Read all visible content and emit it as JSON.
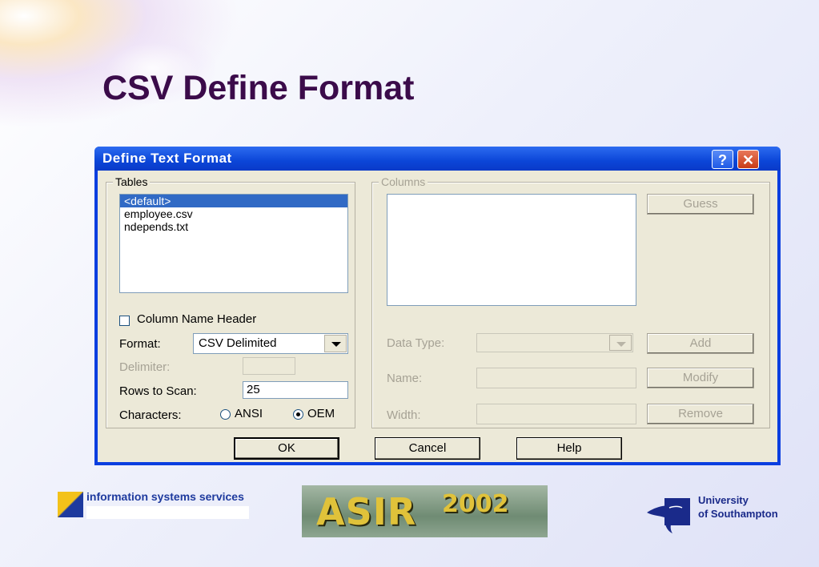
{
  "slide": {
    "title": "CSV Define Format"
  },
  "dialog": {
    "title": "Define Text Format",
    "help_glyph": "?",
    "close_glyph": "✕",
    "tables": {
      "legend": "Tables",
      "items": [
        "<default>",
        "employee.csv",
        "ndepends.txt"
      ],
      "selected_index": 0
    },
    "column_name_header": {
      "label": "Column Name Header",
      "checked": false
    },
    "format": {
      "label": "Format:",
      "value": "CSV Delimited"
    },
    "delimiter": {
      "label": "Delimiter:",
      "value": ""
    },
    "rows_to_scan": {
      "label": "Rows to Scan:",
      "value": "25"
    },
    "characters": {
      "label": "Characters:",
      "options": [
        "ANSI",
        "OEM"
      ],
      "selected": "OEM"
    },
    "columns": {
      "legend": "Columns",
      "data_type_label": "Data Type:",
      "name_label": "Name:",
      "width_label": "Width:"
    },
    "buttons": {
      "guess": "Guess",
      "add": "Add",
      "modify": "Modify",
      "remove": "Remove",
      "ok": "OK",
      "cancel": "Cancel",
      "help": "Help"
    }
  },
  "footer": {
    "iss": "information systems services",
    "asir": "ASIR",
    "asir_year": "2002",
    "uos_line1": "University",
    "uos_line2": "of Southampton"
  },
  "colors": {
    "title": "#3b0b4a",
    "titlebar": "#0b46d8",
    "selection": "#316ac5",
    "dialog_face": "#ece9d8"
  }
}
